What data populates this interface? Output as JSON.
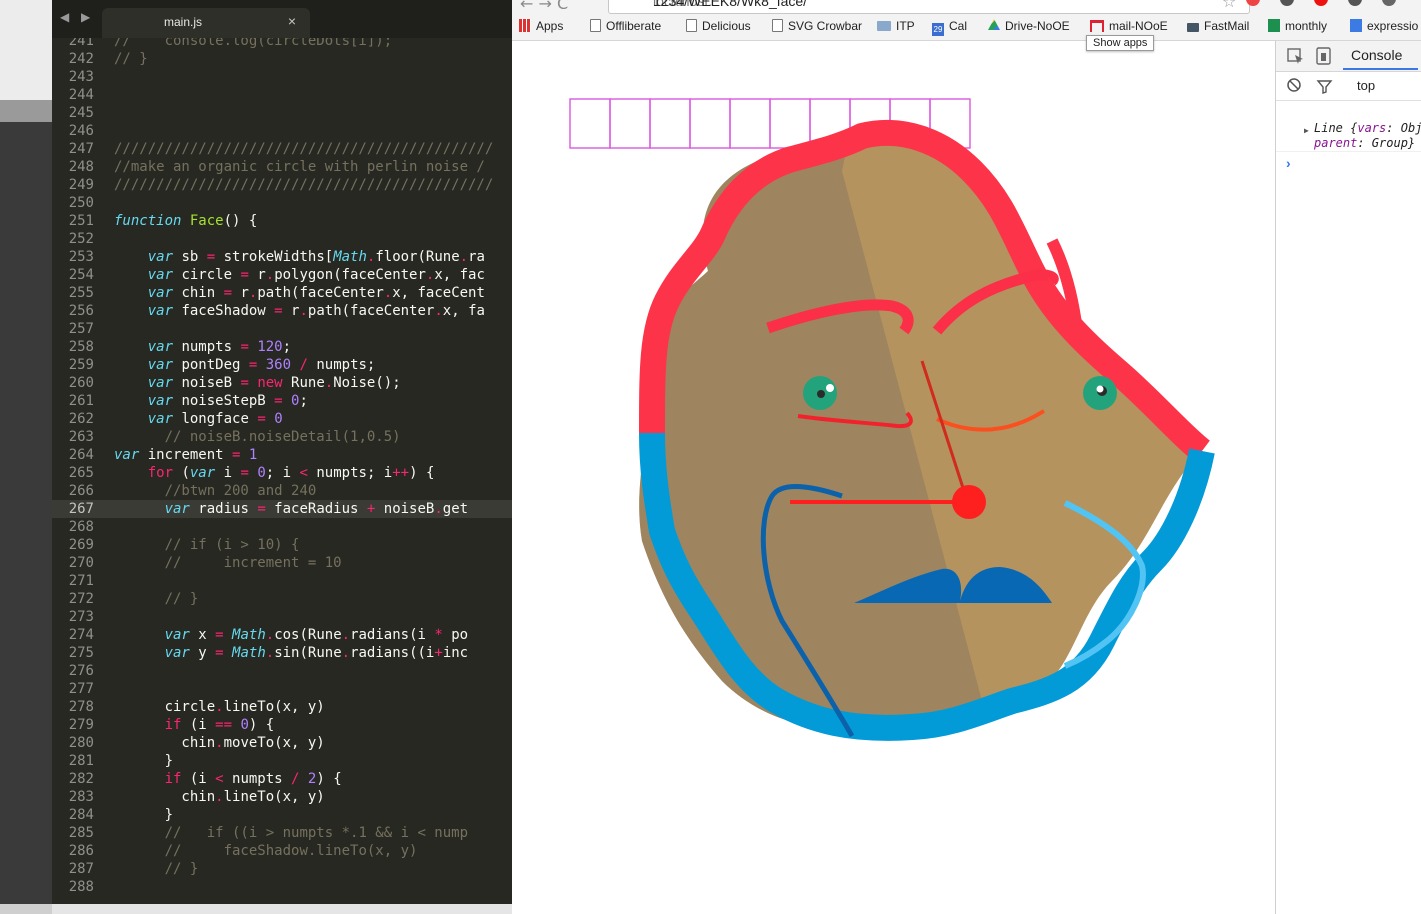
{
  "editor": {
    "tab_name": "main.js",
    "close_glyph": "×",
    "nav_arrows": "◀ ▶",
    "lines": [
      {
        "n": "241",
        "t": [
          [
            "cm",
            "//    console.log(circleDots[i]);"
          ]
        ]
      },
      {
        "n": "242",
        "t": [
          [
            "cm",
            "// }"
          ]
        ]
      },
      {
        "n": "243",
        "t": []
      },
      {
        "n": "244",
        "t": []
      },
      {
        "n": "245",
        "t": []
      },
      {
        "n": "246",
        "t": []
      },
      {
        "n": "247",
        "t": [
          [
            "cm",
            "/////////////////////////////////////////////"
          ]
        ]
      },
      {
        "n": "248",
        "t": [
          [
            "cm",
            "//make an organic circle with perlin noise /"
          ]
        ]
      },
      {
        "n": "249",
        "t": [
          [
            "cm",
            "/////////////////////////////////////////////"
          ]
        ]
      },
      {
        "n": "250",
        "t": []
      },
      {
        "n": "251",
        "t": [
          [
            "kw",
            "function"
          ],
          [
            "",
            " "
          ],
          [
            "fn",
            "Face"
          ],
          [
            "",
            "() {"
          ]
        ]
      },
      {
        "n": "252",
        "t": []
      },
      {
        "n": "253",
        "t": [
          [
            "",
            "    "
          ],
          [
            "kw",
            "var"
          ],
          [
            "",
            " sb "
          ],
          [
            "op",
            "="
          ],
          [
            "",
            " strokeWidths["
          ],
          [
            "cy",
            "Math"
          ],
          [
            "op",
            "."
          ],
          [
            "",
            "floor(Rune"
          ],
          [
            "op",
            "."
          ],
          [
            "",
            "ra"
          ]
        ]
      },
      {
        "n": "254",
        "t": [
          [
            "",
            "    "
          ],
          [
            "kw",
            "var"
          ],
          [
            "",
            " circle "
          ],
          [
            "op",
            "="
          ],
          [
            "",
            " r"
          ],
          [
            "op",
            "."
          ],
          [
            "",
            "polygon(faceCenter"
          ],
          [
            "op",
            "."
          ],
          [
            "",
            "x, fac"
          ]
        ]
      },
      {
        "n": "255",
        "t": [
          [
            "",
            "    "
          ],
          [
            "kw",
            "var"
          ],
          [
            "",
            " chin "
          ],
          [
            "op",
            "="
          ],
          [
            "",
            " r"
          ],
          [
            "op",
            "."
          ],
          [
            "",
            "path(faceCenter"
          ],
          [
            "op",
            "."
          ],
          [
            "",
            "x, faceCent"
          ]
        ]
      },
      {
        "n": "256",
        "t": [
          [
            "",
            "    "
          ],
          [
            "kw",
            "var"
          ],
          [
            "",
            " faceShadow "
          ],
          [
            "op",
            "="
          ],
          [
            "",
            " r"
          ],
          [
            "op",
            "."
          ],
          [
            "",
            "path(faceCenter"
          ],
          [
            "op",
            "."
          ],
          [
            "",
            "x, fa"
          ]
        ]
      },
      {
        "n": "257",
        "t": []
      },
      {
        "n": "258",
        "t": [
          [
            "",
            "    "
          ],
          [
            "kw",
            "var"
          ],
          [
            "",
            " numpts "
          ],
          [
            "op",
            "="
          ],
          [
            "",
            " "
          ],
          [
            "nm",
            "120"
          ],
          [
            "",
            ";"
          ]
        ]
      },
      {
        "n": "259",
        "t": [
          [
            "",
            "    "
          ],
          [
            "kw",
            "var"
          ],
          [
            "",
            " pontDeg "
          ],
          [
            "op",
            "="
          ],
          [
            "",
            " "
          ],
          [
            "nm",
            "360"
          ],
          [
            "",
            " "
          ],
          [
            "op",
            "/"
          ],
          [
            "",
            " numpts;"
          ]
        ]
      },
      {
        "n": "260",
        "t": [
          [
            "",
            "    "
          ],
          [
            "kw",
            "var"
          ],
          [
            "",
            " noiseB "
          ],
          [
            "op",
            "="
          ],
          [
            "",
            " "
          ],
          [
            "op",
            "new"
          ],
          [
            "",
            " Rune"
          ],
          [
            "op",
            "."
          ],
          [
            "",
            "Noise();"
          ]
        ]
      },
      {
        "n": "261",
        "t": [
          [
            "",
            "    "
          ],
          [
            "kw",
            "var"
          ],
          [
            "",
            " noiseStepB "
          ],
          [
            "op",
            "="
          ],
          [
            "",
            " "
          ],
          [
            "nm",
            "0"
          ],
          [
            "",
            ";"
          ]
        ]
      },
      {
        "n": "262",
        "t": [
          [
            "",
            "    "
          ],
          [
            "kw",
            "var"
          ],
          [
            "",
            " longface "
          ],
          [
            "op",
            "="
          ],
          [
            "",
            " "
          ],
          [
            "nm",
            "0"
          ]
        ]
      },
      {
        "n": "263",
        "t": [
          [
            "",
            "      "
          ],
          [
            "cm",
            "// noiseB.noiseDetail(1,0.5)"
          ]
        ]
      },
      {
        "n": "264",
        "t": [
          [
            "kw",
            "var"
          ],
          [
            "",
            " increment "
          ],
          [
            "op",
            "="
          ],
          [
            "",
            " "
          ],
          [
            "nm",
            "1"
          ]
        ]
      },
      {
        "n": "265",
        "t": [
          [
            "",
            "    "
          ],
          [
            "op",
            "for"
          ],
          [
            "",
            " ("
          ],
          [
            "kw",
            "var"
          ],
          [
            "",
            " i "
          ],
          [
            "op",
            "="
          ],
          [
            "",
            " "
          ],
          [
            "nm",
            "0"
          ],
          [
            "",
            "; i "
          ],
          [
            "op",
            "<"
          ],
          [
            "",
            " numpts; i"
          ],
          [
            "op",
            "++"
          ],
          [
            "",
            ") {"
          ]
        ]
      },
      {
        "n": "266",
        "t": [
          [
            "",
            "      "
          ],
          [
            "cm",
            "//btwn 200 and 240"
          ]
        ]
      },
      {
        "n": "267",
        "cur": true,
        "t": [
          [
            "",
            "      "
          ],
          [
            "kw",
            "var"
          ],
          [
            "",
            " radius "
          ],
          [
            "op",
            "="
          ],
          [
            "",
            " faceRadius "
          ],
          [
            "op",
            "+"
          ],
          [
            "",
            " noiseB"
          ],
          [
            "op",
            "."
          ],
          [
            "",
            "get"
          ]
        ]
      },
      {
        "n": "268",
        "t": []
      },
      {
        "n": "269",
        "t": [
          [
            "",
            "      "
          ],
          [
            "cm",
            "// if (i > 10) {"
          ]
        ]
      },
      {
        "n": "270",
        "t": [
          [
            "",
            "      "
          ],
          [
            "cm",
            "//     increment = 10"
          ]
        ]
      },
      {
        "n": "271",
        "t": []
      },
      {
        "n": "272",
        "t": [
          [
            "",
            "      "
          ],
          [
            "cm",
            "// }"
          ]
        ]
      },
      {
        "n": "273",
        "t": []
      },
      {
        "n": "274",
        "t": [
          [
            "",
            "      "
          ],
          [
            "kw",
            "var"
          ],
          [
            "",
            " x "
          ],
          [
            "op",
            "="
          ],
          [
            "",
            " "
          ],
          [
            "cy",
            "Math"
          ],
          [
            "op",
            "."
          ],
          [
            "",
            "cos(Rune"
          ],
          [
            "op",
            "."
          ],
          [
            "",
            "radians(i "
          ],
          [
            "op",
            "*"
          ],
          [
            "",
            " po"
          ]
        ]
      },
      {
        "n": "275",
        "t": [
          [
            "",
            "      "
          ],
          [
            "kw",
            "var"
          ],
          [
            "",
            " y "
          ],
          [
            "op",
            "="
          ],
          [
            "",
            " "
          ],
          [
            "cy",
            "Math"
          ],
          [
            "op",
            "."
          ],
          [
            "",
            "sin(Rune"
          ],
          [
            "op",
            "."
          ],
          [
            "",
            "radians((i"
          ],
          [
            "op",
            "+"
          ],
          [
            "",
            "inc"
          ]
        ]
      },
      {
        "n": "276",
        "t": []
      },
      {
        "n": "277",
        "t": []
      },
      {
        "n": "278",
        "t": [
          [
            "",
            "      circle"
          ],
          [
            "op",
            "."
          ],
          [
            "",
            "lineTo(x, y)"
          ]
        ]
      },
      {
        "n": "279",
        "t": [
          [
            "",
            "      "
          ],
          [
            "op",
            "if"
          ],
          [
            "",
            " (i "
          ],
          [
            "op",
            "=="
          ],
          [
            "",
            " "
          ],
          [
            "nm",
            "0"
          ],
          [
            "",
            ") {"
          ]
        ]
      },
      {
        "n": "280",
        "t": [
          [
            "",
            "        chin"
          ],
          [
            "op",
            "."
          ],
          [
            "",
            "moveTo(x, y)"
          ]
        ]
      },
      {
        "n": "281",
        "t": [
          [
            "",
            "      }"
          ]
        ]
      },
      {
        "n": "282",
        "t": [
          [
            "",
            "      "
          ],
          [
            "op",
            "if"
          ],
          [
            "",
            " (i "
          ],
          [
            "op",
            "<"
          ],
          [
            "",
            " numpts "
          ],
          [
            "op",
            "/"
          ],
          [
            "",
            " "
          ],
          [
            "nm",
            "2"
          ],
          [
            "",
            ") {"
          ]
        ]
      },
      {
        "n": "283",
        "t": [
          [
            "",
            "        chin"
          ],
          [
            "op",
            "."
          ],
          [
            "",
            "lineTo(x, y)"
          ]
        ]
      },
      {
        "n": "284",
        "t": [
          [
            "",
            "      }"
          ]
        ]
      },
      {
        "n": "285",
        "t": [
          [
            "",
            "      "
          ],
          [
            "cm",
            "//   if ((i > numpts *.1 && i < nump"
          ]
        ]
      },
      {
        "n": "286",
        "t": [
          [
            "",
            "      "
          ],
          [
            "cm",
            "//     faceShadow.lineTo(x, y)"
          ]
        ]
      },
      {
        "n": "287",
        "t": [
          [
            "",
            "      "
          ],
          [
            "cm",
            "// }"
          ]
        ]
      },
      {
        "n": "288",
        "t": []
      }
    ]
  },
  "browser": {
    "nav_arrows": "← →  C",
    "url_host": "localhost:",
    "url_path": "1234/WEEK8/Wk8_face/",
    "star_glyph": "☆",
    "bookmarks": [
      {
        "label": "Apps",
        "icon": "apps-grid-icon"
      },
      {
        "label": "Offliberate",
        "icon": "page-icon"
      },
      {
        "label": "Delicious",
        "icon": "page-icon"
      },
      {
        "label": "SVG Crowbar",
        "icon": "page-icon"
      },
      {
        "label": "ITP",
        "icon": "folder-icon"
      },
      {
        "label": "Cal",
        "icon": "calendar-icon",
        "badge": "29"
      },
      {
        "label": "Drive-NoOE",
        "icon": "drive-icon"
      },
      {
        "label": "mail-NOoE",
        "icon": "gmail-icon"
      },
      {
        "label": "FastMail",
        "icon": "mail-icon"
      },
      {
        "label": "monthly",
        "icon": "sheets-icon"
      },
      {
        "label": "expressio",
        "icon": "docs-icon"
      }
    ],
    "tooltip": "Show apps",
    "ext_colors": [
      "#e44",
      "#555",
      "#e11",
      "#555",
      "#666"
    ]
  },
  "devtools": {
    "tab": "Console",
    "filter_context": "top",
    "log_line1_pre": "Line {",
    "log_line1_key": "vars",
    "log_line1_post": ": Obj",
    "log_line2_key": "parent",
    "log_line2_post": ": Group}",
    "prompt": "›"
  },
  "drawing": {
    "grid_cells": 10,
    "colors": {
      "face_fill": "#b4935f",
      "shadow": "#8c7a5e",
      "hair_stroke": "#fd3449",
      "beard_stroke": "#039ad8",
      "brow": "#fb2f47",
      "eye_fill": "#23a37b",
      "nose": "#d02b1c",
      "mouth": "#fe1f1f",
      "left_eye_line": "#f2222d",
      "right_eye_line": "#fb4f1f",
      "mustache": "#0868b4",
      "chin_curve": "#0b62aa",
      "light_blue_curve": "#52c4f4",
      "grid": "#dc58e0"
    }
  }
}
